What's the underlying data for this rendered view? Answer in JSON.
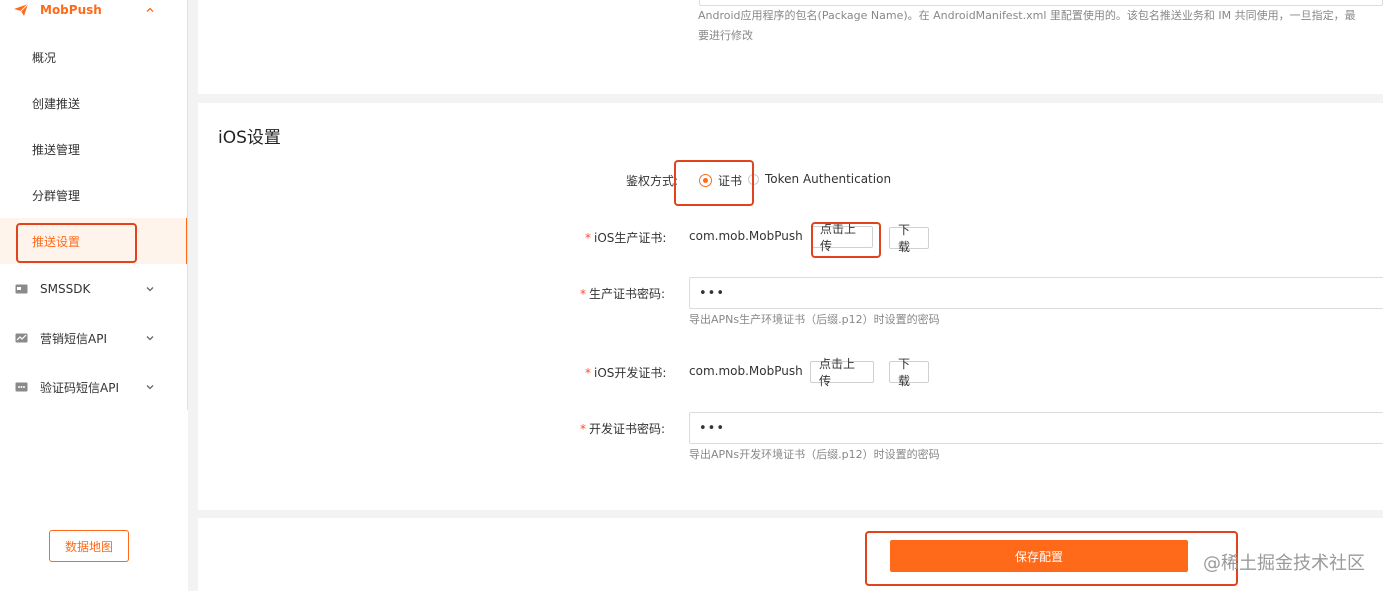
{
  "sidebar": {
    "brand": {
      "label": "MobPush",
      "icon": "paper-plane-icon"
    },
    "items": [
      {
        "label": "概况"
      },
      {
        "label": "创建推送"
      },
      {
        "label": "推送管理"
      },
      {
        "label": "分群管理"
      },
      {
        "label": "推送设置",
        "active": true
      }
    ],
    "groups": [
      {
        "label": "SMSSDK",
        "icon": "card-icon"
      },
      {
        "label": "营销短信API",
        "icon": "chart-icon"
      },
      {
        "label": "验证码短信API",
        "icon": "sms-icon"
      }
    ],
    "map_button": "数据地图"
  },
  "android": {
    "package_hint": "Android应用程序的包名(Package Name)。在 AndroidManifest.xml 里配置使用的。该包名推送业务和 IM 共同使用，一旦指定，最",
    "package_hint_line2": "要进行修改"
  },
  "ios": {
    "title": "iOS设置",
    "auth": {
      "label": "鉴权方式:",
      "option_cert": "证书",
      "option_token": "Token Authentication",
      "selected": "证书"
    },
    "prod_cert": {
      "label": "iOS生产证书:",
      "value": "com.mob.MobPush",
      "upload": "点击上传",
      "download": "下载"
    },
    "prod_pwd": {
      "label": "生产证书密码:",
      "value": "•••",
      "hint": "导出APNs生产环境证书（后缀.p12）时设置的密码"
    },
    "dev_cert": {
      "label": "iOS开发证书:",
      "value": "com.mob.MobPush",
      "upload": "点击上传",
      "download": "下载"
    },
    "dev_pwd": {
      "label": "开发证书密码:",
      "value": "•••",
      "hint": "导出APNs开发环境证书（后缀.p12）时设置的密码"
    },
    "required_mark": "*"
  },
  "footer": {
    "save_label": "保存配置"
  },
  "watermark": "@稀土掘金技术社区",
  "colors": {
    "accent": "#ff6a1a",
    "annotation": "#e0441e"
  }
}
